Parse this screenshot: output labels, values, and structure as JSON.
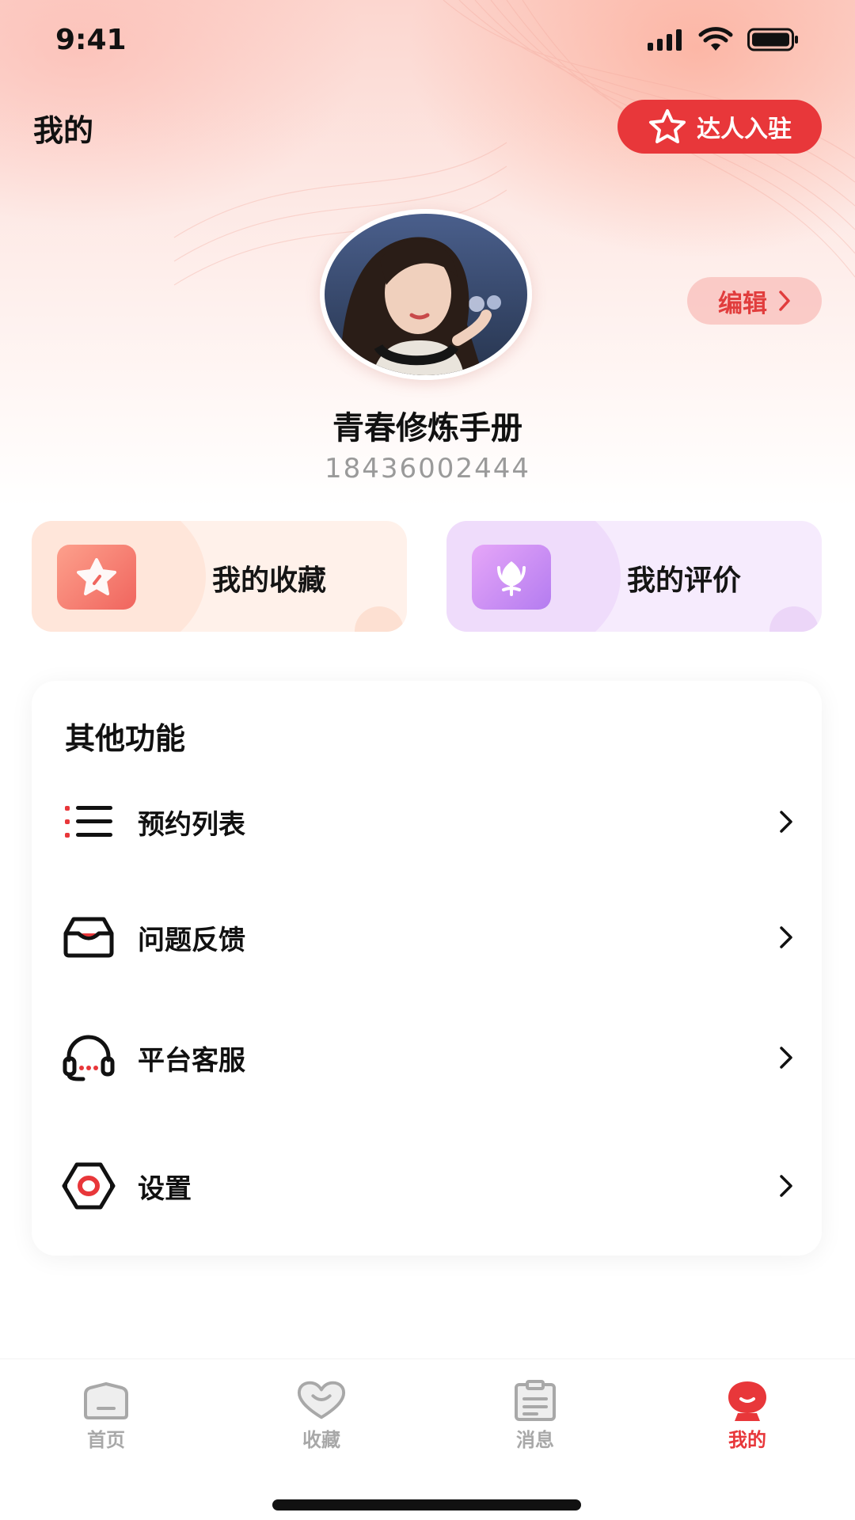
{
  "status_bar": {
    "time": "9:41"
  },
  "header": {
    "title": "我的",
    "join_label": "达人入驻"
  },
  "profile": {
    "edit_label": "编辑",
    "name": "青春修炼手册",
    "phone": "18436002444"
  },
  "quick_actions": [
    {
      "label": "我的收藏",
      "icon": "star-icon"
    },
    {
      "label": "我的评价",
      "icon": "flower-icon"
    }
  ],
  "functions": {
    "title": "其他功能",
    "items": [
      {
        "label": "预约列表",
        "icon": "list-icon"
      },
      {
        "label": "问题反馈",
        "icon": "inbox-icon"
      },
      {
        "label": "平台客服",
        "icon": "headset-icon"
      },
      {
        "label": "设置",
        "icon": "gear-icon"
      }
    ]
  },
  "tabbar": {
    "items": [
      {
        "label": "首页",
        "icon": "home-icon",
        "active": false
      },
      {
        "label": "收藏",
        "icon": "heart-icon",
        "active": false
      },
      {
        "label": "消息",
        "icon": "clipboard-icon",
        "active": false
      },
      {
        "label": "我的",
        "icon": "profile-icon",
        "active": true
      }
    ]
  },
  "colors": {
    "accent": "#e8373a",
    "muted_text": "#9a9a9a"
  }
}
